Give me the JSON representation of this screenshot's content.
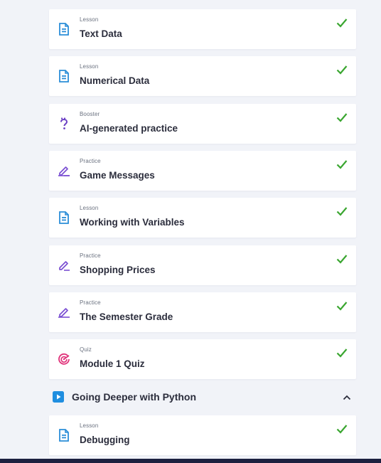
{
  "colors": {
    "check": "#3aa630",
    "lesson_icon": "#2b8ed8",
    "practice_icon": "#7a4fd2",
    "booster_icon": "#6b3fc4",
    "quiz_icon": "#e0337a",
    "section_play": "#1f8ee0"
  },
  "items": [
    {
      "type": "Lesson",
      "title": "Text Data",
      "icon": "lesson-doc-icon",
      "completed": true
    },
    {
      "type": "Lesson",
      "title": "Numerical Data",
      "icon": "lesson-doc-icon",
      "completed": true
    },
    {
      "type": "Booster",
      "title": "AI-generated practice",
      "icon": "question-mark-icon",
      "completed": true
    },
    {
      "type": "Practice",
      "title": "Game Messages",
      "icon": "pencil-icon",
      "completed": true
    },
    {
      "type": "Lesson",
      "title": "Working with Variables",
      "icon": "lesson-doc-icon",
      "completed": true
    },
    {
      "type": "Practice",
      "title": "Shopping Prices",
      "icon": "pencil-icon",
      "completed": true
    },
    {
      "type": "Practice",
      "title": "The Semester Grade",
      "icon": "pencil-icon",
      "completed": true
    },
    {
      "type": "Quiz",
      "title": "Module 1 Quiz",
      "icon": "target-icon",
      "completed": true
    }
  ],
  "section": {
    "title": "Going Deeper with Python",
    "icon": "play-icon",
    "expanded": true
  },
  "section_items": [
    {
      "type": "Lesson",
      "title": "Debugging",
      "icon": "lesson-doc-icon",
      "completed": true
    }
  ]
}
